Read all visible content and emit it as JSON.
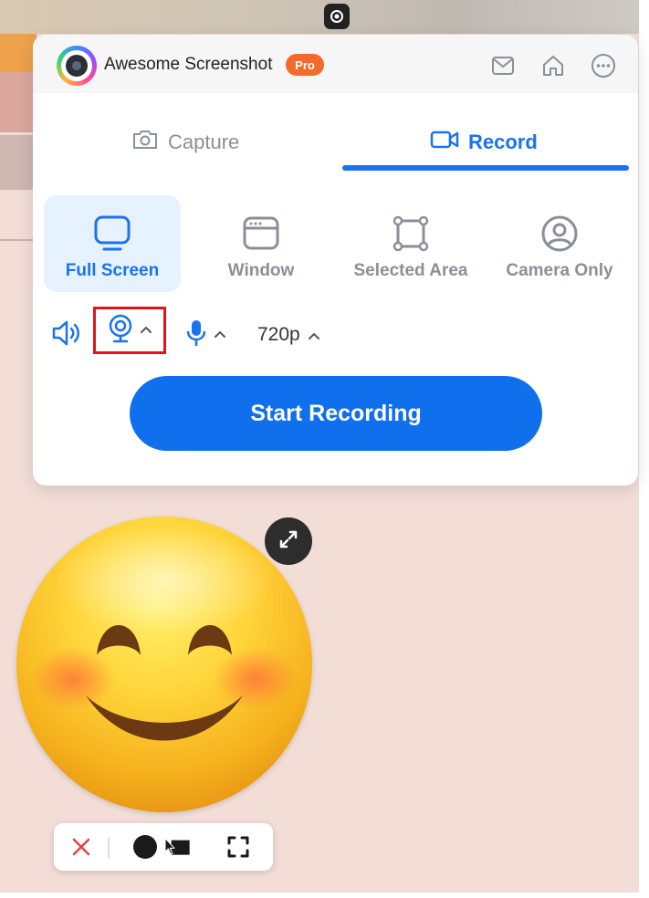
{
  "app": {
    "title": "Awesome Screenshot",
    "badge": "Pro"
  },
  "header_icons": [
    "mail-icon",
    "home-icon",
    "more-icon"
  ],
  "tabs": [
    {
      "label": "Capture",
      "icon": "camera-icon",
      "active": false
    },
    {
      "label": "Record",
      "icon": "video-camera-icon",
      "active": true
    }
  ],
  "modes": [
    {
      "label": "Full Screen",
      "icon": "monitor-icon",
      "active": true
    },
    {
      "label": "Window",
      "icon": "browser-window-icon",
      "active": false
    },
    {
      "label": "Selected Area",
      "icon": "selection-area-icon",
      "active": false
    },
    {
      "label": "Camera Only",
      "icon": "user-circle-icon",
      "active": false
    }
  ],
  "controls": {
    "resolution": "720p"
  },
  "start_button": "Start Recording",
  "colors": {
    "accent": "#1a73ee",
    "badge": "#f26b2b",
    "highlight": "#e3121b"
  }
}
